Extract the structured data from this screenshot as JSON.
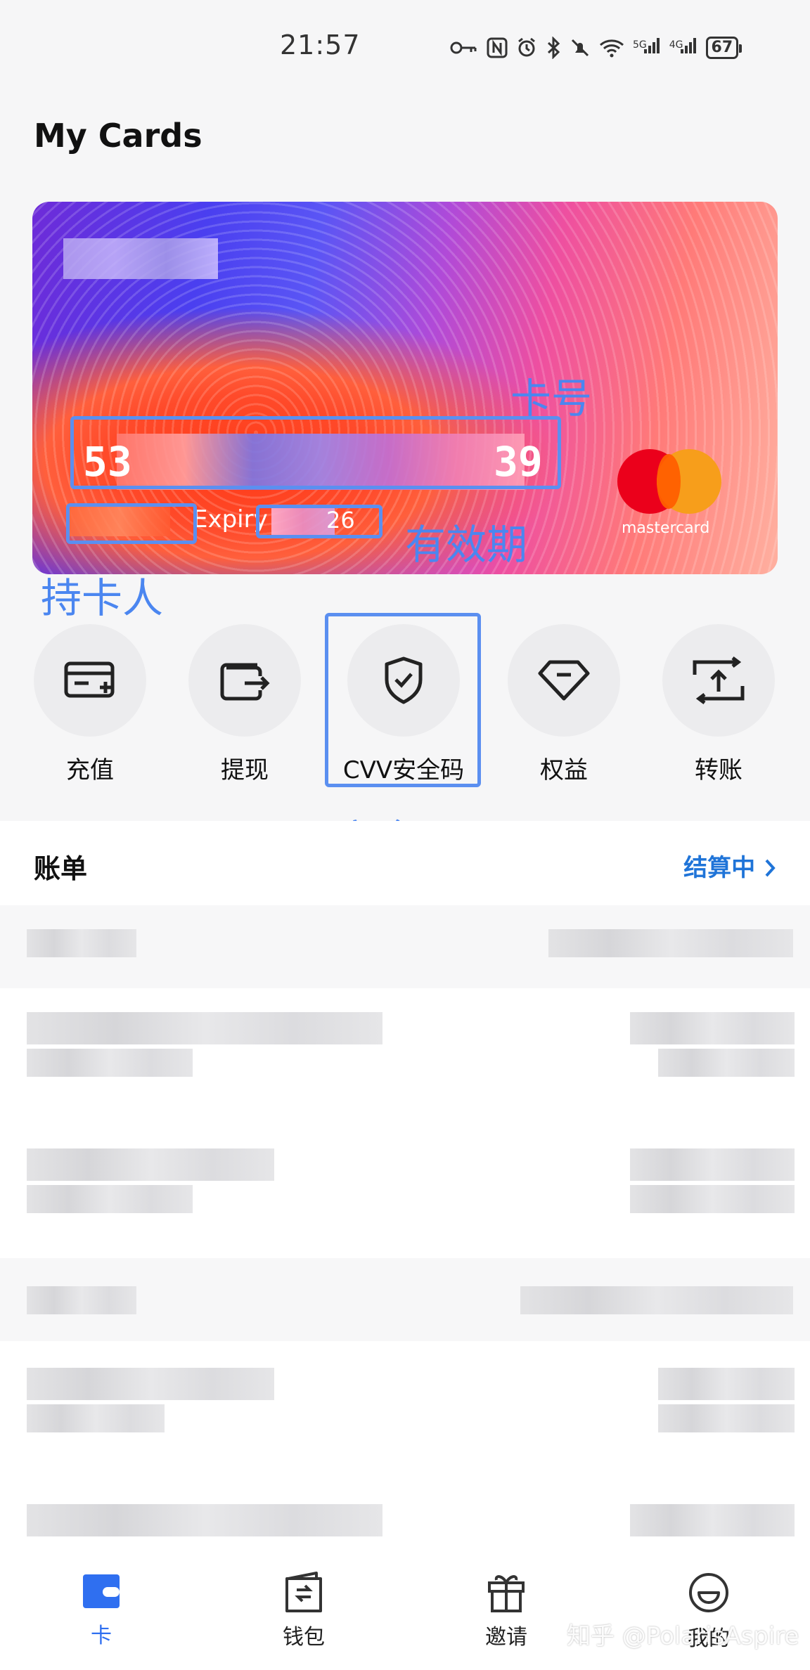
{
  "status_bar": {
    "time": "21:57",
    "signal_1": "5G",
    "signal_2": "4G",
    "battery": "67"
  },
  "header": {
    "title": "My Cards"
  },
  "card": {
    "number_start": "53",
    "number_end": "39",
    "expiry_label": "Expiry",
    "expiry_value": "26",
    "brand": "mastercard"
  },
  "annotations": {
    "card_number": "卡号",
    "expiry": "有效期",
    "holder": "持卡人",
    "security_code": "安全码"
  },
  "actions": [
    {
      "label": "充值",
      "icon": "card-add-icon"
    },
    {
      "label": "提现",
      "icon": "wallet-out-icon"
    },
    {
      "label": "CVV安全码",
      "icon": "shield-check-icon"
    },
    {
      "label": "权益",
      "icon": "diamond-icon"
    },
    {
      "label": "转账",
      "icon": "transfer-icon"
    }
  ],
  "bill": {
    "title": "账单",
    "status_link": "结算中"
  },
  "bottom_nav": [
    {
      "label": "卡",
      "icon": "card-icon",
      "active": true
    },
    {
      "label": "钱包",
      "icon": "wallet-icon",
      "active": false
    },
    {
      "label": "邀请",
      "icon": "gift-icon",
      "active": false
    },
    {
      "label": "我的",
      "icon": "smiley-icon",
      "active": false
    }
  ],
  "watermark": "知乎 @PolarisAspire",
  "colors": {
    "accent_blue": "#1f74d8",
    "annotation_blue": "#4b86f0",
    "active_nav": "#2f6ff0"
  }
}
